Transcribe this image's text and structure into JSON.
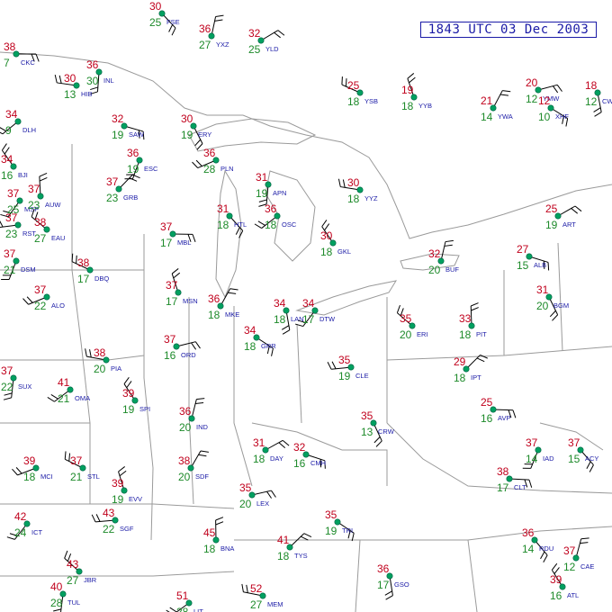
{
  "title": "1843 UTC 03 Dec 2003",
  "colors": {
    "temperature": "#c0001c",
    "dewpoint": "#1d8a2a",
    "station_code": "#1a1aa6",
    "weather_symbol": "#b000b0",
    "boundary": "#9a9a9a",
    "barb": "#000000",
    "station_marker": "#00a060"
  },
  "stations": [
    {
      "code": "CKC",
      "t": "38",
      "td": "7"
    },
    {
      "code": "FSE",
      "t": "30",
      "td": "25"
    },
    {
      "code": "INL",
      "t": "36",
      "td": "30"
    },
    {
      "code": "DLH",
      "t": "34",
      "td": "9"
    },
    {
      "code": "HIB",
      "t": "30",
      "td": "13"
    },
    {
      "code": "BJI",
      "t": "34",
      "td": "16"
    },
    {
      "code": "YXZ",
      "t": "36",
      "td": "27"
    },
    {
      "code": "YLD",
      "t": "32",
      "td": "25"
    },
    {
      "code": "SAW",
      "t": "32",
      "td": "19"
    },
    {
      "code": "ERY",
      "t": "30",
      "td": "19"
    },
    {
      "code": "ESC",
      "t": "36",
      "td": "19"
    },
    {
      "code": "PLN",
      "t": "36",
      "td": "28"
    },
    {
      "code": "YSB",
      "t": "25",
      "td": "18"
    },
    {
      "code": "YYB",
      "t": "19",
      "td": "18"
    },
    {
      "code": "YWA",
      "t": "21",
      "td": "14"
    },
    {
      "code": "YMW",
      "t": "20",
      "td": "12"
    },
    {
      "code": "XHF",
      "t": "12",
      "td": "10"
    },
    {
      "code": "CWP",
      "t": "18",
      "td": "12"
    },
    {
      "code": "MSP",
      "t": "37",
      "td": "25"
    },
    {
      "code": "RST",
      "t": "37",
      "td": "23"
    },
    {
      "code": "EAU",
      "t": "38",
      "td": "27"
    },
    {
      "code": "AUW",
      "t": "37",
      "td": "23"
    },
    {
      "code": "GRB",
      "t": "37",
      "td": "23"
    },
    {
      "code": "MBL",
      "t": "37",
      "td": "17"
    },
    {
      "code": "HTL",
      "t": "31",
      "td": "18"
    },
    {
      "code": "APN",
      "t": "31",
      "td": "19"
    },
    {
      "code": "OSC",
      "t": "36",
      "td": "18"
    },
    {
      "code": "YYZ",
      "t": "30",
      "td": "18"
    },
    {
      "code": "GKL",
      "t": "30",
      "td": "18"
    },
    {
      "code": "BUF",
      "t": "32",
      "td": "20"
    },
    {
      "code": "ART",
      "t": "25",
      "td": "19"
    },
    {
      "code": "ALB",
      "t": "27",
      "td": "15"
    },
    {
      "code": "BGM",
      "t": "31",
      "td": "20"
    },
    {
      "code": "DSM",
      "t": "37",
      "td": "21"
    },
    {
      "code": "ALO",
      "t": "37",
      "td": "22"
    },
    {
      "code": "DBQ",
      "t": "38",
      "td": "17"
    },
    {
      "code": "MSN",
      "t": "37",
      "td": "17"
    },
    {
      "code": "MKE",
      "t": "36",
      "td": "18"
    },
    {
      "code": "ORD",
      "t": "37",
      "td": "16"
    },
    {
      "code": "GRR",
      "t": "34",
      "td": "18"
    },
    {
      "code": "LAN",
      "t": "34",
      "td": "18"
    },
    {
      "code": "DTW",
      "t": "34",
      "td": "17"
    },
    {
      "code": "CLE",
      "t": "35",
      "td": "19"
    },
    {
      "code": "ERI",
      "t": "35",
      "td": "20"
    },
    {
      "code": "PIT",
      "t": "33",
      "td": "18"
    },
    {
      "code": "IPT",
      "t": "29",
      "td": "18"
    },
    {
      "code": "AVP",
      "t": "25",
      "td": "16"
    },
    {
      "code": "ACY",
      "t": "37",
      "td": "15"
    },
    {
      "code": "SUX",
      "t": "37",
      "td": "22"
    },
    {
      "code": "OMA",
      "t": "41",
      "td": "21"
    },
    {
      "code": "PIA",
      "t": "38",
      "td": "20"
    },
    {
      "code": "SPI",
      "t": "39",
      "td": "19"
    },
    {
      "code": "IND",
      "t": "36",
      "td": "20"
    },
    {
      "code": "DAY",
      "t": "31",
      "td": "18"
    },
    {
      "code": "CMH",
      "t": "32",
      "td": "16"
    },
    {
      "code": "CRW",
      "t": "35",
      "td": "13"
    },
    {
      "code": "IAD",
      "t": "37",
      "td": "14"
    },
    {
      "code": "MCI",
      "t": "39",
      "td": "18"
    },
    {
      "code": "STL",
      "t": "37",
      "td": "21"
    },
    {
      "code": "EVV",
      "t": "39",
      "td": "19"
    },
    {
      "code": "SDF",
      "t": "38",
      "td": "20"
    },
    {
      "code": "LEX",
      "t": "35",
      "td": "20"
    },
    {
      "code": "TRI",
      "t": "35",
      "td": "19"
    },
    {
      "code": "GSO",
      "t": "36",
      "td": "17"
    },
    {
      "code": "ICT",
      "t": "42",
      "td": "24"
    },
    {
      "code": "SGF",
      "t": "43",
      "td": "22"
    },
    {
      "code": "JBR",
      "t": "43",
      "td": "27"
    },
    {
      "code": "BNA",
      "t": "45",
      "td": "18"
    },
    {
      "code": "TYS",
      "t": "41",
      "td": "18"
    },
    {
      "code": "CLT",
      "t": "38",
      "td": "17"
    },
    {
      "code": "RDU",
      "t": "36",
      "td": "14"
    },
    {
      "code": "TUL",
      "t": "40",
      "td": "28"
    },
    {
      "code": "LIT",
      "t": "51",
      "td": "28"
    },
    {
      "code": "MEM",
      "t": "52",
      "td": "27"
    },
    {
      "code": "ATL",
      "t": "39",
      "td": "16"
    },
    {
      "code": "CAE",
      "t": "37",
      "td": "12"
    }
  ]
}
